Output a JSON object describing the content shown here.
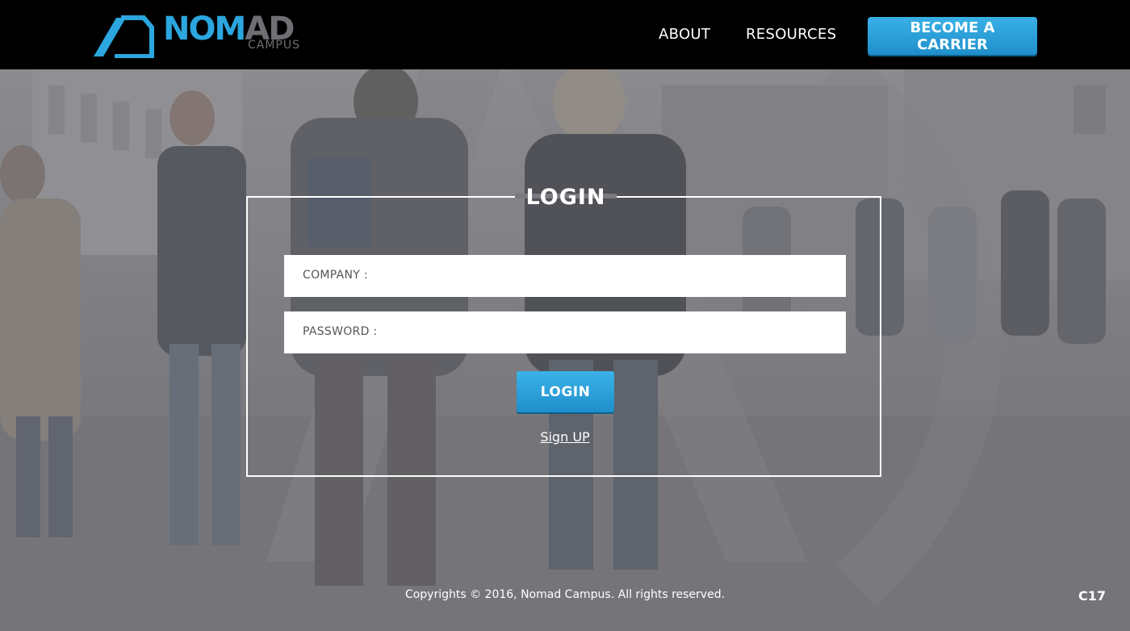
{
  "brand": {
    "word_primary": "NOM",
    "word_secondary": "AD",
    "subtitle": "CAMPUS",
    "accent_color": "#2ba6de",
    "muted_color": "#6e6f73"
  },
  "nav": {
    "about_label": "ABOUT",
    "resources_label": "RESOURCES",
    "cta_label": "BECOME A CARRIER"
  },
  "login": {
    "title": "LOGIN",
    "company_label": "COMPANY  :",
    "company_value": "",
    "password_label": "PASSWORD  :",
    "password_value": "",
    "submit_label": "LOGIN",
    "signup_label": "Sign UP"
  },
  "footer": {
    "copyright": "Copyrights © 2016, Nomad Campus. All rights reserved.",
    "corner_tag": "C17"
  },
  "colors": {
    "header_bg": "#000000",
    "button_blue": "#2ba6de",
    "overlay": "#7a7a7e"
  }
}
